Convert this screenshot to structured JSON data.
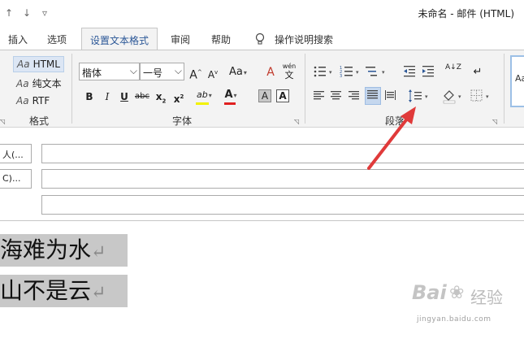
{
  "window": {
    "title": "未命名  -  邮件 (HTML)",
    "qat": {
      "undo": "↑",
      "redo": "↓",
      "customize": "▿"
    }
  },
  "tabs": [
    {
      "label": "插入"
    },
    {
      "label": "选项"
    },
    {
      "label": "设置文本格式",
      "active": true
    },
    {
      "label": "审阅"
    },
    {
      "label": "帮助"
    },
    {
      "label": "操作说明搜索"
    }
  ],
  "ribbon": {
    "format_group": {
      "label": "格式",
      "items": [
        {
          "prefix": "Aa",
          "label": "HTML",
          "selected": true
        },
        {
          "prefix": "Aa",
          "label": "纯文本"
        },
        {
          "prefix": "Aa",
          "label": "RTF"
        }
      ]
    },
    "font_group": {
      "label": "字体",
      "font_name": "楷体",
      "font_size": "一号",
      "grow": "A",
      "shrink": "A",
      "change_case": "Aa",
      "clear_format": "A",
      "phonetic_top": "wén",
      "phonetic_bottom": "文",
      "bold": "B",
      "italic": "I",
      "underline": "U",
      "strike": "abc",
      "subscript": "x",
      "subscript_mark": "2",
      "superscript": "x",
      "superscript_mark": "2",
      "highlight": "ab",
      "font_color": "A",
      "char_shading": "A",
      "char_border": "A",
      "highlight_color": "#f2f200",
      "font_color_value": "#e02020"
    },
    "paragraph_group": {
      "label": "段落",
      "sort": "A↓Z",
      "show_marks": "↵"
    },
    "styles_group": {
      "preview": "Aa"
    }
  },
  "fields": {
    "to_label": "人(...",
    "cc_label": "C)..."
  },
  "body": {
    "line1": "海难为水",
    "line2": "山不是云",
    "para_mark": "↵"
  },
  "watermark": {
    "brand": "Bai",
    "brand2": "经验",
    "domain": "jingyan.baidu.com"
  }
}
